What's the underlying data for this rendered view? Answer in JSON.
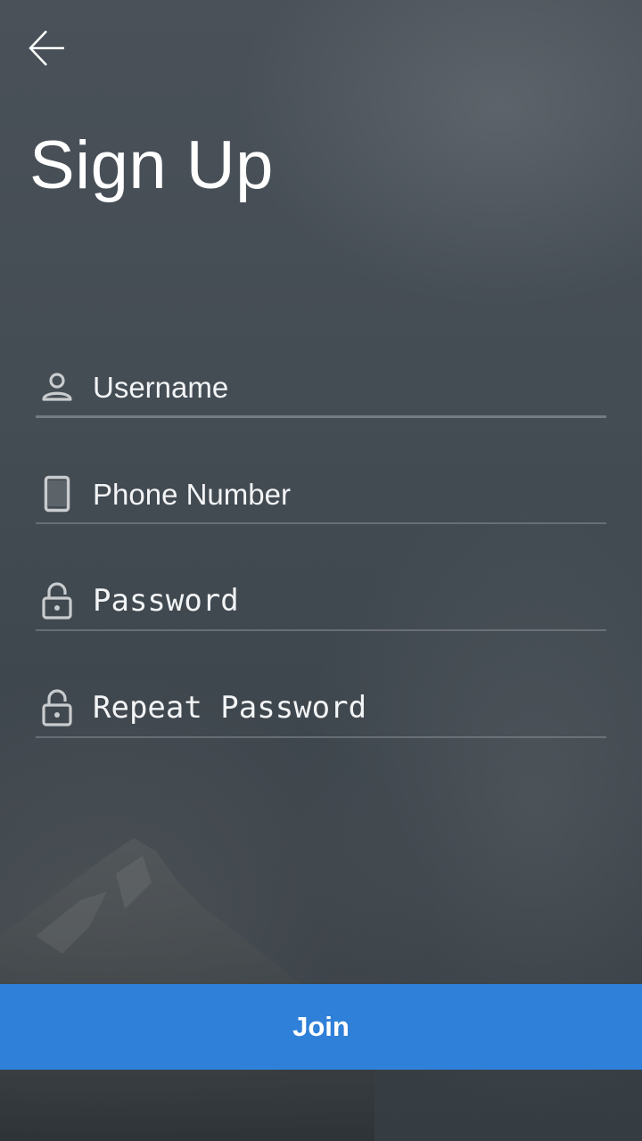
{
  "header": {
    "back_icon": "arrow-left-icon",
    "title": "Sign Up"
  },
  "form": {
    "username": {
      "placeholder": "Username",
      "icon": "person-icon"
    },
    "phone": {
      "placeholder": "Phone Number",
      "icon": "phone-icon"
    },
    "password": {
      "placeholder": "Password",
      "icon": "lock-icon"
    },
    "repeat_password": {
      "placeholder": "Repeat Password",
      "icon": "lock-icon"
    }
  },
  "actions": {
    "join_label": "Join"
  },
  "colors": {
    "primary": "#2f80d8",
    "text": "#ffffff"
  }
}
